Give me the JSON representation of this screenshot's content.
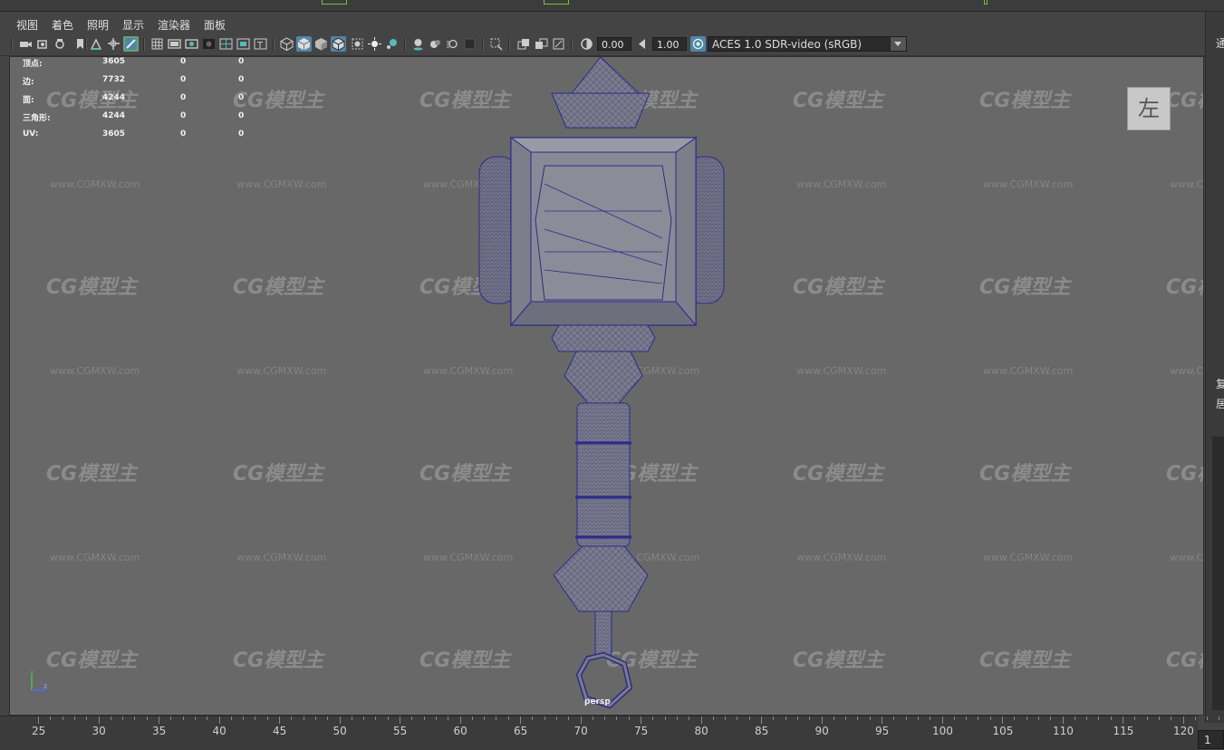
{
  "menu": {
    "items": [
      "视图",
      "着色",
      "照明",
      "显示",
      "渲染器",
      "面板"
    ]
  },
  "toolbar": {
    "icons": [
      "camera-select-icon",
      "camera-attr-icon",
      "bookmark-icon",
      "image-plane-icon",
      "2d-pan-icon",
      "grease-pencil-icon",
      "grid-icon",
      "film-gate-icon",
      "resolution-gate-icon",
      "gate-mask-icon",
      "field-chart-icon",
      "safe-action-icon",
      "safe-title-icon",
      "wireframe-icon",
      "smooth-shade-icon",
      "default-material-icon",
      "wireframe-on-shaded-icon",
      "xray-icon",
      "textured-icon",
      "use-lights-icon",
      "shadows-icon",
      "screen-ao-icon",
      "motion-blur-icon",
      "anti-alias-icon",
      "depth-of-field-icon",
      "isolate-select-icon",
      "xray-joints-icon",
      "xray-active-icon",
      "backface-culling-icon",
      "exposure-icon",
      "gamma-icon",
      "color-management-icon"
    ],
    "exposure": "0.00",
    "gamma": "1.00",
    "color_space": "ACES 1.0 SDR-video (sRGB)"
  },
  "hud": {
    "rows": [
      {
        "label": "顶点:",
        "a": "3605",
        "b": "0",
        "c": "0"
      },
      {
        "label": "边:",
        "a": "7732",
        "b": "0",
        "c": "0"
      },
      {
        "label": "面:",
        "a": "4244",
        "b": "0",
        "c": "0"
      },
      {
        "label": "三角形:",
        "a": "4244",
        "b": "0",
        "c": "0"
      },
      {
        "label": "UV:",
        "a": "3605",
        "b": "0",
        "c": "0"
      }
    ]
  },
  "viewcube": {
    "label": "左"
  },
  "camera": {
    "label": "persp"
  },
  "axes": {
    "y": "y",
    "z": "z"
  },
  "watermark": {
    "logo": "CG模型主",
    "url": "www.CGMXW.com"
  },
  "right_panel": {
    "chars": [
      "通",
      "复",
      "居"
    ]
  },
  "timeline": {
    "ticks": [
      "25",
      "30",
      "35",
      "40",
      "45",
      "50",
      "55",
      "60",
      "65",
      "70",
      "75",
      "80",
      "85",
      "90",
      "95",
      "100",
      "105",
      "110",
      "115",
      "120"
    ],
    "current_frame": "1"
  },
  "colors": {
    "viewport_bg": "#686868",
    "wire": "#2b2b8a",
    "mesh_fill": "#7b7b88",
    "accent": "#5285a6"
  }
}
